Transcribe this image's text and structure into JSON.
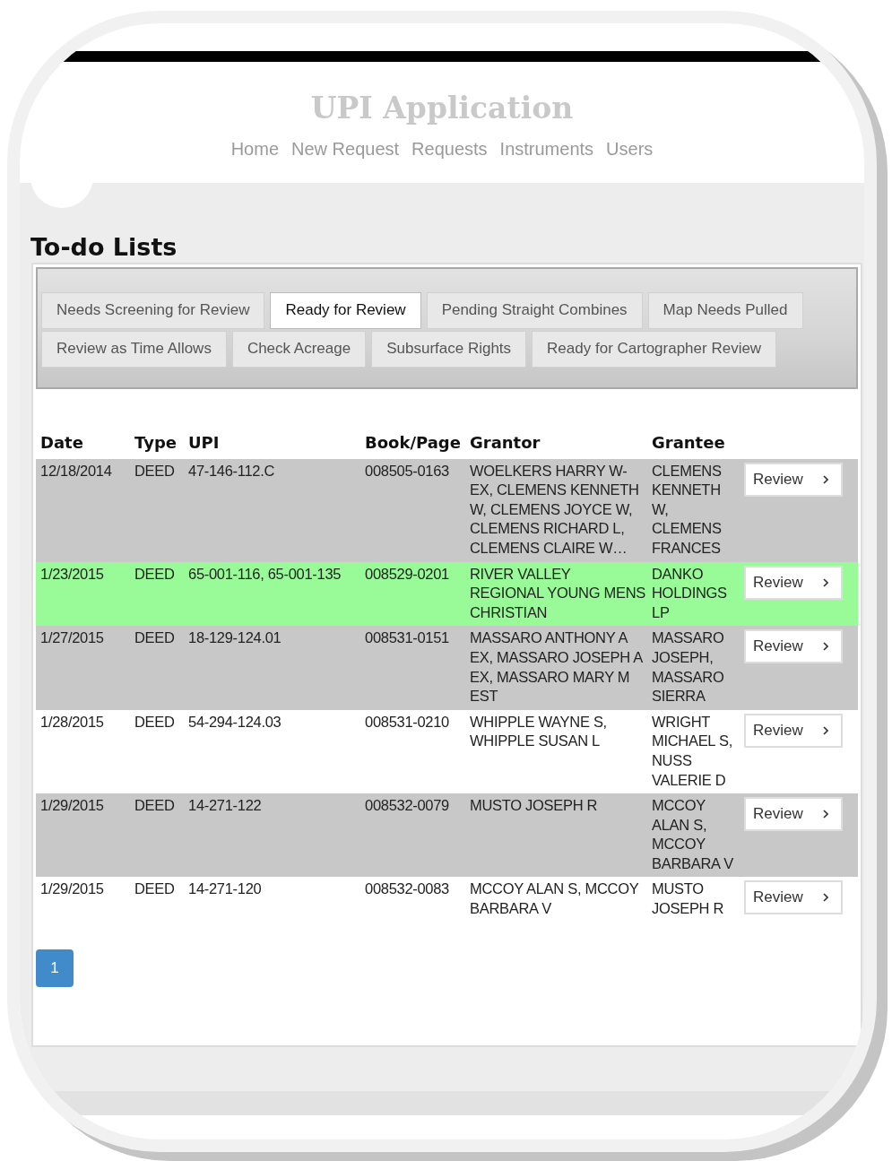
{
  "header": {
    "title": "UPI Application",
    "nav": [
      {
        "label": "Home"
      },
      {
        "label": "New Request"
      },
      {
        "label": "Requests"
      },
      {
        "label": "Instruments"
      },
      {
        "label": "Users"
      }
    ]
  },
  "heading": "To-do Lists",
  "tabs": [
    [
      {
        "label": "Needs Screening for Review",
        "selected": false
      },
      {
        "label": "Ready for Review",
        "selected": true
      },
      {
        "label": "Pending Straight Combines",
        "selected": false
      },
      {
        "label": "Map Needs Pulled",
        "selected": false
      }
    ],
    [
      {
        "label": "Review as Time Allows",
        "selected": false
      },
      {
        "label": "Check Acreage",
        "selected": false
      },
      {
        "label": "Subsurface Rights",
        "selected": false
      },
      {
        "label": "Ready for Cartographer Review",
        "selected": false
      }
    ]
  ],
  "table": {
    "columns": [
      "Date",
      "Type",
      "UPI",
      "Book/Page",
      "Grantor",
      "Grantee"
    ],
    "rows": [
      {
        "highlighted": false,
        "cells": [
          "12/18/2014",
          "DEED",
          "47-146-112.C",
          "008505-0163",
          "WOELKERS HARRY W-EX, CLEMENS KENNETH W, CLEMENS JOYCE W, CLEMENS RICHARD L, CLEMENS CLAIRE W…",
          "CLEMENS KENNETH W, CLEMENS FRANCES"
        ],
        "action": "Review"
      },
      {
        "highlighted": true,
        "cells": [
          "1/23/2015",
          "DEED",
          "65-001-116, 65-001-135",
          "008529-0201",
          "RIVER VALLEY REGIONAL YOUNG MENS CHRISTIAN",
          "DANKO HOLDINGS LP"
        ],
        "action": "Review"
      },
      {
        "highlighted": false,
        "cells": [
          "1/27/2015",
          "DEED",
          "18-129-124.01",
          "008531-0151",
          "MASSARO ANTHONY A EX, MASSARO JOSEPH A EX, MASSARO MARY M EST",
          "MASSARO JOSEPH, MASSARO SIERRA"
        ],
        "action": "Review"
      },
      {
        "highlighted": false,
        "cells": [
          "1/28/2015",
          "DEED",
          "54-294-124.03",
          "008531-0210",
          "WHIPPLE WAYNE S, WHIPPLE SUSAN L",
          "WRIGHT MICHAEL S, NUSS VALERIE D"
        ],
        "action": "Review"
      },
      {
        "highlighted": false,
        "cells": [
          "1/29/2015",
          "DEED",
          "14-271-122",
          "008532-0079",
          "MUSTO JOSEPH R",
          "MCCOY ALAN S, MCCOY BARBARA V"
        ],
        "action": "Review"
      },
      {
        "highlighted": false,
        "cells": [
          "1/29/2015",
          "DEED",
          "14-271-120",
          "008532-0083",
          "MCCOY ALAN S, MCCOY BARBARA V",
          "MUSTO JOSEPH R"
        ],
        "action": "Review"
      }
    ]
  },
  "pagination": [
    {
      "label": "1",
      "selected": true
    }
  ]
}
